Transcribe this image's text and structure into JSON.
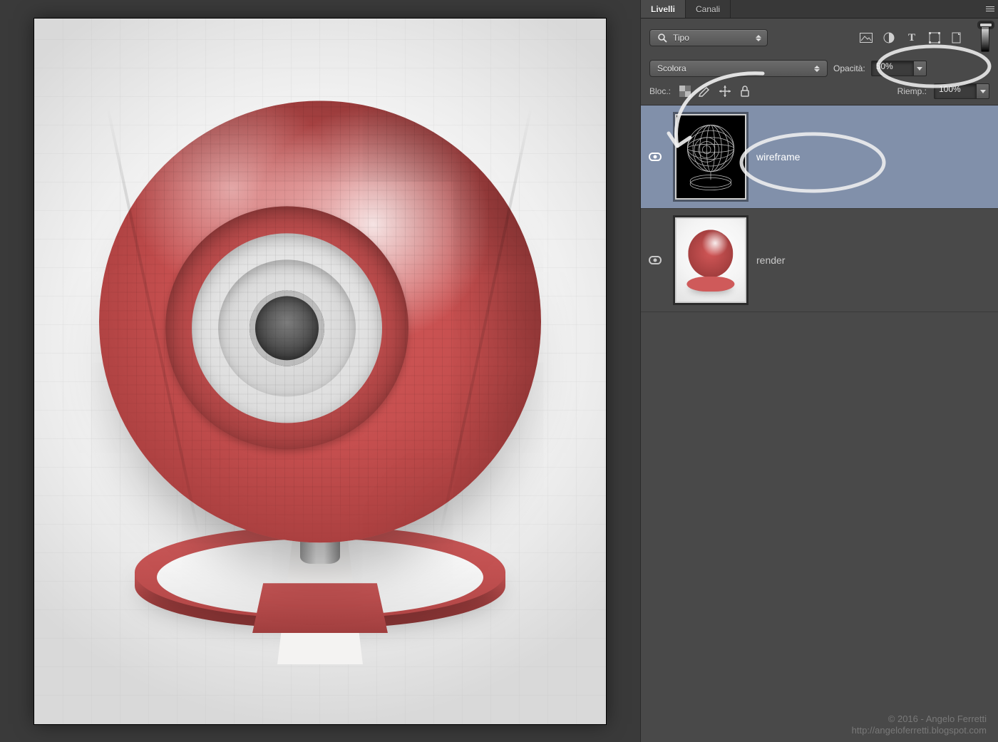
{
  "panel": {
    "tabs": {
      "layers": "Livelli",
      "channels": "Canali"
    },
    "filter": {
      "icon": "search-icon",
      "label": "Tipo"
    },
    "quick_icons": [
      "image-icon",
      "adjust-icon",
      "type-icon",
      "shape-icon",
      "smartobj-icon"
    ],
    "blend_mode": "Scolora",
    "opacity_label": "Opacità:",
    "opacity_value": "50%",
    "lock_label": "Bloc.:",
    "fill_label": "Riemp.:",
    "fill_value": "100%",
    "layers": [
      {
        "name": "wireframe",
        "selected": true,
        "visible": true,
        "thumb": "wire"
      },
      {
        "name": "render",
        "selected": false,
        "visible": true,
        "thumb": "render"
      }
    ]
  },
  "credit": {
    "line1": "© 2016 - Angelo Ferretti",
    "line2": "http://angeloferretti.blogspot.com"
  }
}
